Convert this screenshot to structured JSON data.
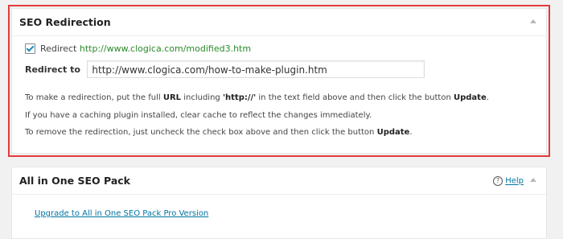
{
  "seo_redirection": {
    "title": "SEO Redirection",
    "checkbox_label": "Redirect",
    "current_url": "http://www.clogica.com/modified3.htm",
    "redirect_to_label": "Redirect to",
    "redirect_to_value": "http://www.clogica.com/how-to-make-plugin.htm",
    "info_lines": {
      "line1_pre": "To make a redirection, put the full ",
      "line1_url": "URL",
      "line1_mid": " including ",
      "line1_http": "'http://'",
      "line1_post": " in the text field above and then click the button ",
      "line1_update": "Update",
      "line1_end": ".",
      "line2": "If you have a caching plugin installed, clear cache to reflect the changes immediately.",
      "line3_pre": "To remove the redirection, just uncheck the check box above and then click the button ",
      "line3_update": "Update",
      "line3_end": "."
    }
  },
  "aioseo": {
    "title": "All in One SEO Pack",
    "help_icon": "?",
    "help_label": "Help",
    "upgrade_link": "Upgrade to All in One SEO Pack Pro Version"
  },
  "colors": {
    "highlight_border": "#e23b3b",
    "link": "#0074a2",
    "url_green": "#2a8a2a"
  },
  "icons": [
    "checkbox-checked-icon",
    "collapse-arrow-icon",
    "help-circle-icon"
  ]
}
